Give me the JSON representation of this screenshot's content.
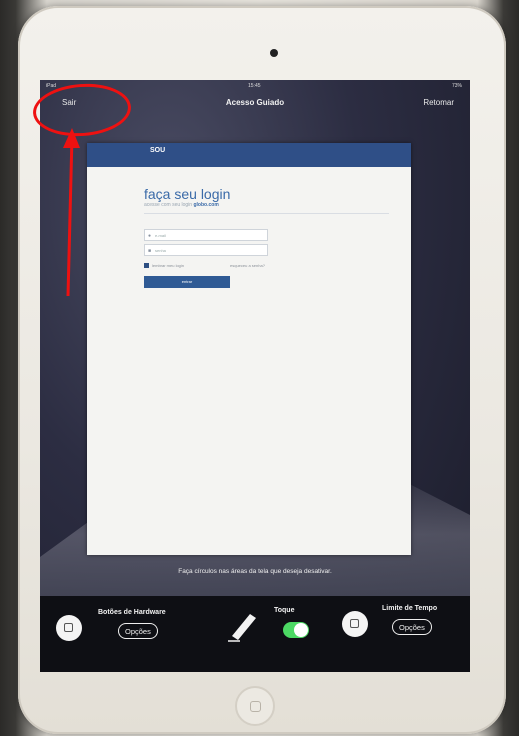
{
  "status_bar": {
    "carrier": "iPad",
    "time": "15:45",
    "battery": "73%"
  },
  "nav": {
    "exit_label": "Sair",
    "title": "Acesso Guiado",
    "resume_label": "Retomar"
  },
  "webpage": {
    "logo": "SOU",
    "title": "faça seu login",
    "subtitle_prefix": "acesse com seu login",
    "subtitle_brand": "globo.com",
    "email_placeholder": "e-mail",
    "password_placeholder": "senha",
    "remember_label": "lembrar meu login",
    "forgot_label": "esqueceu a senha?",
    "submit_label": "entrar"
  },
  "instruction": "Faça círculos nas áreas da tela que deseja desativar.",
  "bottom": {
    "hardware_label": "Botões de Hardware",
    "hardware_options": "Opções",
    "touch_label": "Toque",
    "touch_enabled": true,
    "time_limit_label": "Limite de Tempo",
    "time_limit_options": "Opções"
  },
  "colors": {
    "annotation": "#ee1111",
    "toggle_on": "#4cd964",
    "header_blue": "#2f4f87"
  },
  "icons": [
    "camera-icon",
    "pen-icon",
    "home-button-icon",
    "square-icon"
  ]
}
